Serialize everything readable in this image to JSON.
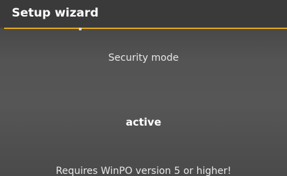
{
  "header": {
    "title": "Setup wizard",
    "accent_color": "#e3a817"
  },
  "main": {
    "mode_label": "Security mode",
    "mode_value": "active",
    "requirement_note": "Requires WinPO version 5 or higher!"
  }
}
